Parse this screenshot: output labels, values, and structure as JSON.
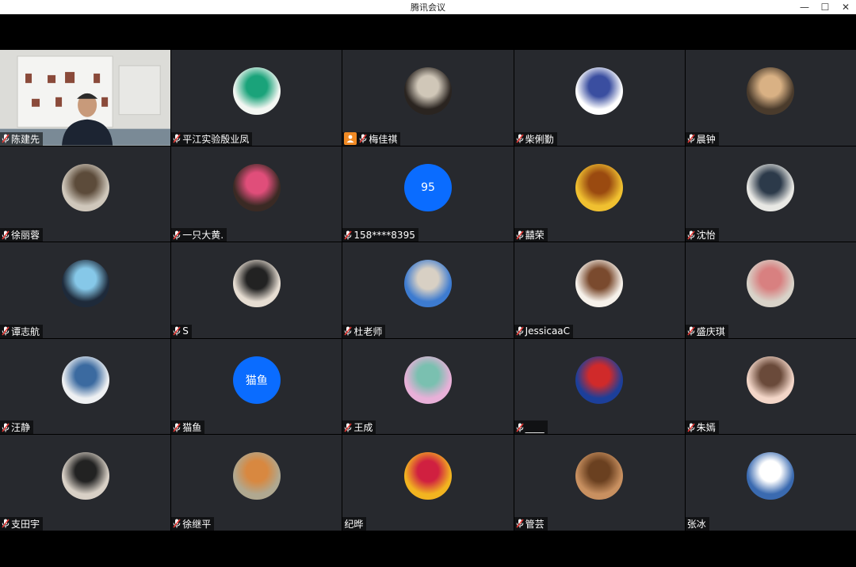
{
  "window": {
    "title": "腾讯会议",
    "controls": [
      "—",
      "☐",
      "✕"
    ]
  },
  "participants": [
    {
      "name": "陈建先",
      "kind": "video"
    },
    {
      "name": "平江实验殷业凤",
      "kind": "img",
      "colors": [
        "#f3f6f2",
        "#1aa37a"
      ]
    },
    {
      "name": "梅佳祺",
      "kind": "img",
      "host": true,
      "colors": [
        "#2a2420",
        "#d0c7b8"
      ]
    },
    {
      "name": "柴俐勤",
      "kind": "img",
      "colors": [
        "#ffffff",
        "#3a4ea0"
      ]
    },
    {
      "name": "晨钟",
      "kind": "img",
      "colors": [
        "#4a3b2c",
        "#d9b184"
      ]
    },
    {
      "name": "徐丽蓉",
      "kind": "img",
      "colors": [
        "#cfc7bb",
        "#5c4b3a"
      ]
    },
    {
      "name": "一只大黄.",
      "kind": "img",
      "colors": [
        "#3a2a24",
        "#e04e7a"
      ]
    },
    {
      "name": "158****8395",
      "kind": "text",
      "avatar_text": "95"
    },
    {
      "name": "囍荣",
      "kind": "img",
      "colors": [
        "#f0c030",
        "#9a4a10"
      ]
    },
    {
      "name": "沈怡",
      "kind": "img",
      "colors": [
        "#e8e8e4",
        "#2c3a4a"
      ]
    },
    {
      "name": "谭志航",
      "kind": "img",
      "colors": [
        "#1e2a3a",
        "#86c8e8"
      ]
    },
    {
      "name": "S",
      "kind": "img",
      "colors": [
        "#e6ddd2",
        "#222222"
      ]
    },
    {
      "name": "杜老师",
      "kind": "img",
      "colors": [
        "#3d7bd0",
        "#d8d0c4"
      ]
    },
    {
      "name": "JessicaaC",
      "kind": "img",
      "colors": [
        "#f6f1ea",
        "#7a4a2e"
      ]
    },
    {
      "name": "盛庆琪",
      "kind": "img",
      "colors": [
        "#d8d2c8",
        "#d88080"
      ]
    },
    {
      "name": "汪静",
      "kind": "img",
      "colors": [
        "#eef0f2",
        "#3b6aa0"
      ]
    },
    {
      "name": "猫鱼",
      "kind": "text",
      "avatar_text": "猫鱼"
    },
    {
      "name": "王成",
      "kind": "img",
      "colors": [
        "#e8b0d8",
        "#7ac0b0"
      ]
    },
    {
      "name": "____",
      "kind": "img",
      "colors": [
        "#1c3f9a",
        "#d02a2a"
      ]
    },
    {
      "name": "朱嫣",
      "kind": "img",
      "colors": [
        "#f3d6c8",
        "#6a4a3a"
      ]
    },
    {
      "name": "支田宇",
      "kind": "img",
      "colors": [
        "#d8d0c6",
        "#222222"
      ]
    },
    {
      "name": "徐继平",
      "kind": "img",
      "colors": [
        "#b0a890",
        "#d88840"
      ]
    },
    {
      "name": "纪晔",
      "kind": "img",
      "mic": false,
      "colors": [
        "#f2b420",
        "#d02040"
      ]
    },
    {
      "name": "管芸",
      "kind": "img",
      "colors": [
        "#c89060",
        "#6a4020"
      ]
    },
    {
      "name": "张冰",
      "kind": "img",
      "mic": false,
      "colors": [
        "#3a6ab0",
        "#ffffff"
      ]
    }
  ]
}
